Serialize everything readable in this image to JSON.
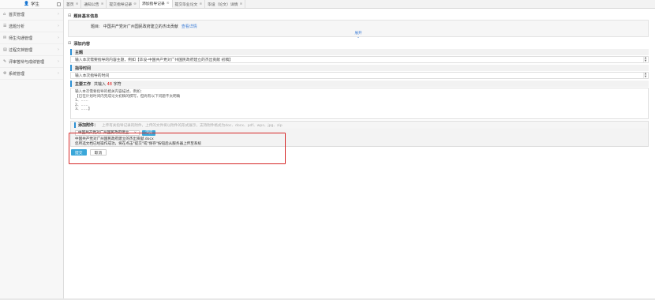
{
  "sidebar": {
    "role_label": "学生",
    "items": [
      {
        "label": "首页管理",
        "icon": "⌂"
      },
      {
        "label": "选题分析",
        "icon": "☰"
      },
      {
        "label": "师生沟通管理",
        "icon": "✉"
      },
      {
        "label": "过程文档管理",
        "icon": "▤"
      },
      {
        "label": "评审答辩与成绩管理",
        "icon": "✎"
      },
      {
        "label": "系统管理",
        "icon": "⚙"
      }
    ]
  },
  "tabs": [
    {
      "label": "首页",
      "closable": true
    },
    {
      "label": "通知公告",
      "closable": true
    },
    {
      "label": "提交指导记录",
      "closable": true
    },
    {
      "label": "添加指导记录",
      "closable": true,
      "active": true
    },
    {
      "label": "提交毕业论文",
      "closable": true
    },
    {
      "label": "毕设（论文）详情",
      "closable": true
    }
  ],
  "main": {
    "basic_info_title": "题目基本信息",
    "topic_prefix": "题目:",
    "topic_title": "中国共产党对广州国民政府建立的杰出贡献",
    "view_details_link": "查看详情",
    "expand_label": "展开",
    "add_content_title": "添加内容",
    "subject_label": "主题",
    "subject_placeholder": "输入本次需要指导的内容主题，例如【毕设-中国共产党对广州国民政府建立的杰出贡献 初稿】",
    "time_label": "指导时间",
    "time_placeholder": "输入本次指导的时间",
    "work_label": "主要工作",
    "work_note_prefix": "共输入",
    "work_count": "48",
    "work_note_suffix": "字符",
    "work_lines": [
      "输入本次需要指导的相关内容描述，例如：",
      "【已在计划时间内完成论文初稿的撰写，但尚有以下问题不太明确",
      "1、……",
      "2、……",
      "3、……】"
    ],
    "attach_label": "添加附件：",
    "attach_hint": "上传有关指导记录的附件，上传的文件将以附件的形式展示，支持附件格式为doc、docx、pdf、wps、jpg、zip",
    "file_input_value": "中国共产党对广州国民政府建立",
    "clear_icon": "×",
    "browse_label": "浏览",
    "uploaded_file": "中国共产党对广州国民政府建立的杰出贡献.docx",
    "upload_status": "您所选文档已经操作成功，将在点击\"提交\"或\"保存\"按钮后从服务器上传至系统",
    "submit_label": "提交",
    "cancel_label": "取消"
  },
  "colors": {
    "accent": "#3aa7d9",
    "link": "#3a7bd5",
    "highlight_border": "#d62828",
    "count_red": "#e02020"
  }
}
